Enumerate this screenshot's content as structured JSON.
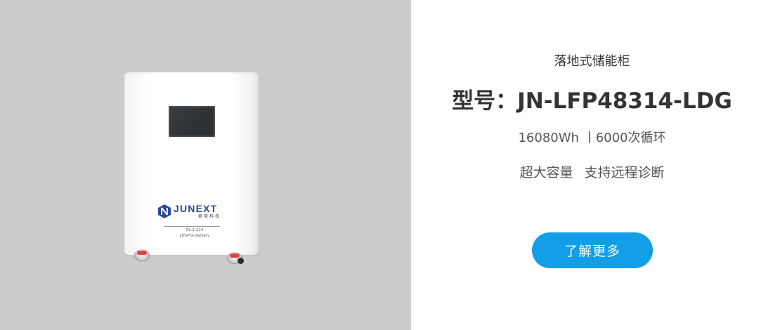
{
  "product_image": {
    "brand_name": "JUNEXT",
    "brand_sub": "君能科技",
    "label_spec": "51.2-314",
    "label_type": "LiFePO₄ Battery"
  },
  "info": {
    "category": "落地式储能柜",
    "model_text": "型号：JN-LFP48314-LDG",
    "specs": {
      "energy": "16080Wh",
      "separator": "丨",
      "cycles": "6000次循环"
    },
    "features": {
      "first": "超大容量",
      "second": "支持远程诊断"
    },
    "cta_label": "了解更多"
  },
  "colors": {
    "image_bg": "#cbcbcb",
    "brand_blue": "#2a4a9a",
    "cta_bg": "#139ee8",
    "text_dark": "#333333",
    "text_muted": "#555555"
  }
}
